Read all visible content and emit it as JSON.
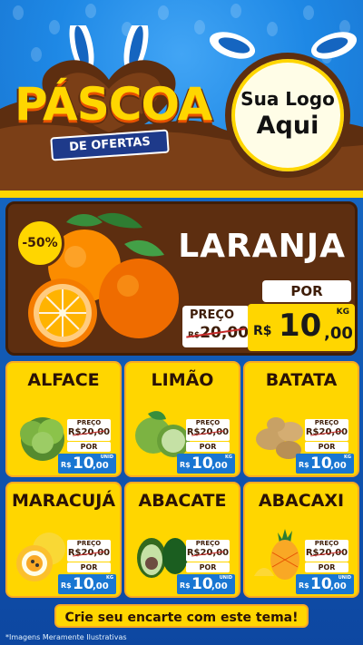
{
  "header": {
    "title": "PÁSCOA",
    "subtitle": "DE OFERTAS",
    "logo_line1": "Sua Logo",
    "logo_line2": "Aqui"
  },
  "hero": {
    "name": "LARANJA",
    "discount": "-50%",
    "preco_label": "PREÇO",
    "old_currency": "R$",
    "old_price": "20,00",
    "por_label": "POR",
    "currency": "R$",
    "price_int": "10",
    "price_dec": ",00",
    "unit": "KG"
  },
  "products": [
    {
      "name": "ALFACE",
      "preco_label": "PREÇO",
      "old_price": "R$20,00",
      "por_label": "POR",
      "currency": "R$",
      "price_int": "10",
      "price_dec": ",00",
      "unit": "UNID"
    },
    {
      "name": "LIMÃO",
      "preco_label": "PREÇO",
      "old_price": "R$20,00",
      "por_label": "POR",
      "currency": "R$",
      "price_int": "10",
      "price_dec": ",00",
      "unit": "KG"
    },
    {
      "name": "BATATA",
      "preco_label": "PREÇO",
      "old_price": "R$20,00",
      "por_label": "POR",
      "currency": "R$",
      "price_int": "10",
      "price_dec": ",00",
      "unit": "KG"
    },
    {
      "name": "MARACUJÁ",
      "preco_label": "PREÇO",
      "old_price": "R$20,00",
      "por_label": "POR",
      "currency": "R$",
      "price_int": "10",
      "price_dec": ",00",
      "unit": "KG"
    },
    {
      "name": "ABACATE",
      "preco_label": "PREÇO",
      "old_price": "R$20,00",
      "por_label": "POR",
      "currency": "R$",
      "price_int": "10",
      "price_dec": ",00",
      "unit": "UNID"
    },
    {
      "name": "ABACAXI",
      "preco_label": "PREÇO",
      "old_price": "R$20,00",
      "por_label": "POR",
      "currency": "R$",
      "price_int": "10",
      "price_dec": ",00",
      "unit": "UNID"
    }
  ],
  "cta": "Crie seu encarte com este tema!",
  "footnote": "*Imagens Meramente Ilustrativas",
  "colors": {
    "blue": "#1e88e5",
    "chocolate": "#5d2e10",
    "yellow": "#ffd600",
    "price_blue": "#1976d2"
  }
}
